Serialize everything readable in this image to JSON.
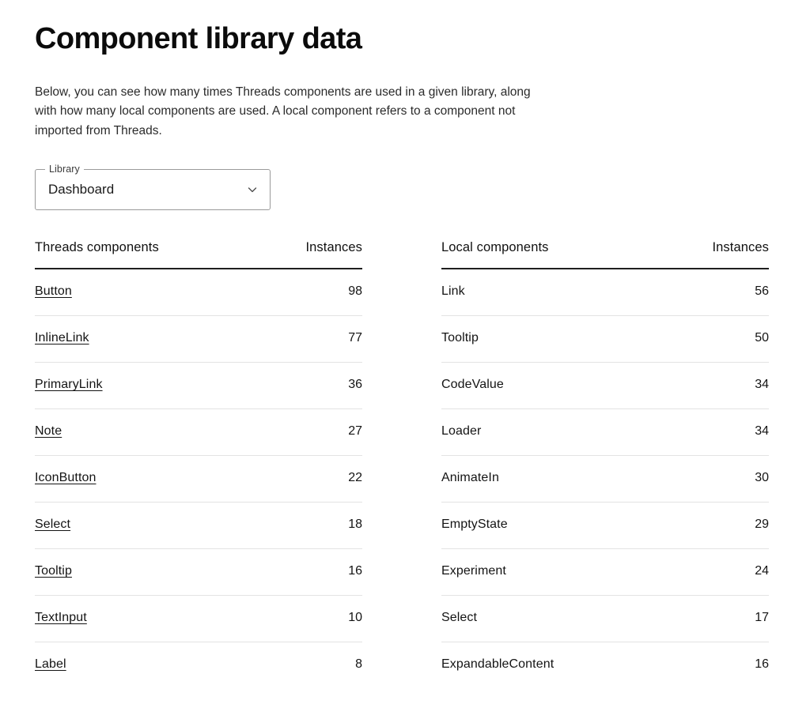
{
  "page": {
    "title": "Component library data",
    "intro": "Below, you can see how many times Threads components are used in a given library, along with how many local components are used. A local component refers to a component not imported from Threads."
  },
  "library_select": {
    "label": "Library",
    "value": "Dashboard",
    "icon": "chevron-down-icon"
  },
  "threads_table": {
    "col_name": "Threads components",
    "col_value": "Instances",
    "rows": [
      {
        "name": "Button",
        "value": "98"
      },
      {
        "name": "InlineLink",
        "value": "77"
      },
      {
        "name": "PrimaryLink",
        "value": "36"
      },
      {
        "name": "Note",
        "value": "27"
      },
      {
        "name": "IconButton",
        "value": "22"
      },
      {
        "name": "Select",
        "value": "18"
      },
      {
        "name": "Tooltip",
        "value": "16"
      },
      {
        "name": "TextInput",
        "value": "10"
      },
      {
        "name": "Label",
        "value": "8"
      }
    ]
  },
  "local_table": {
    "col_name": "Local components",
    "col_value": "Instances",
    "rows": [
      {
        "name": "Link",
        "value": "56"
      },
      {
        "name": "Tooltip",
        "value": "50"
      },
      {
        "name": "CodeValue",
        "value": "34"
      },
      {
        "name": "Loader",
        "value": "34"
      },
      {
        "name": "AnimateIn",
        "value": "30"
      },
      {
        "name": "EmptyState",
        "value": "29"
      },
      {
        "name": "Experiment",
        "value": "24"
      },
      {
        "name": "Select",
        "value": "17"
      },
      {
        "name": "ExpandableContent",
        "value": "16"
      }
    ]
  },
  "colors": {
    "background": "#ffffff",
    "text": "#1a1a1a",
    "header_rule": "#1f1f1f",
    "row_rule": "#e3e3e3",
    "field_border": "#9a9a9a"
  }
}
